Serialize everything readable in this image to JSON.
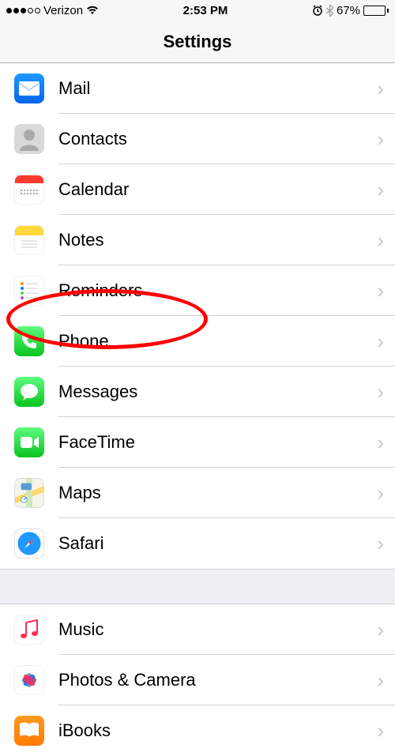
{
  "status_bar": {
    "carrier": "Verizon",
    "time": "2:53 PM",
    "battery_pct": "67%"
  },
  "nav": {
    "title": "Settings"
  },
  "rows": {
    "mail": "Mail",
    "contacts": "Contacts",
    "calendar": "Calendar",
    "notes": "Notes",
    "reminders": "Reminders",
    "phone": "Phone",
    "messages": "Messages",
    "facetime": "FaceTime",
    "maps": "Maps",
    "safari": "Safari",
    "music": "Music",
    "photos": "Photos & Camera",
    "ibooks": "iBooks"
  },
  "annotation": {
    "circled_item": "phone"
  }
}
